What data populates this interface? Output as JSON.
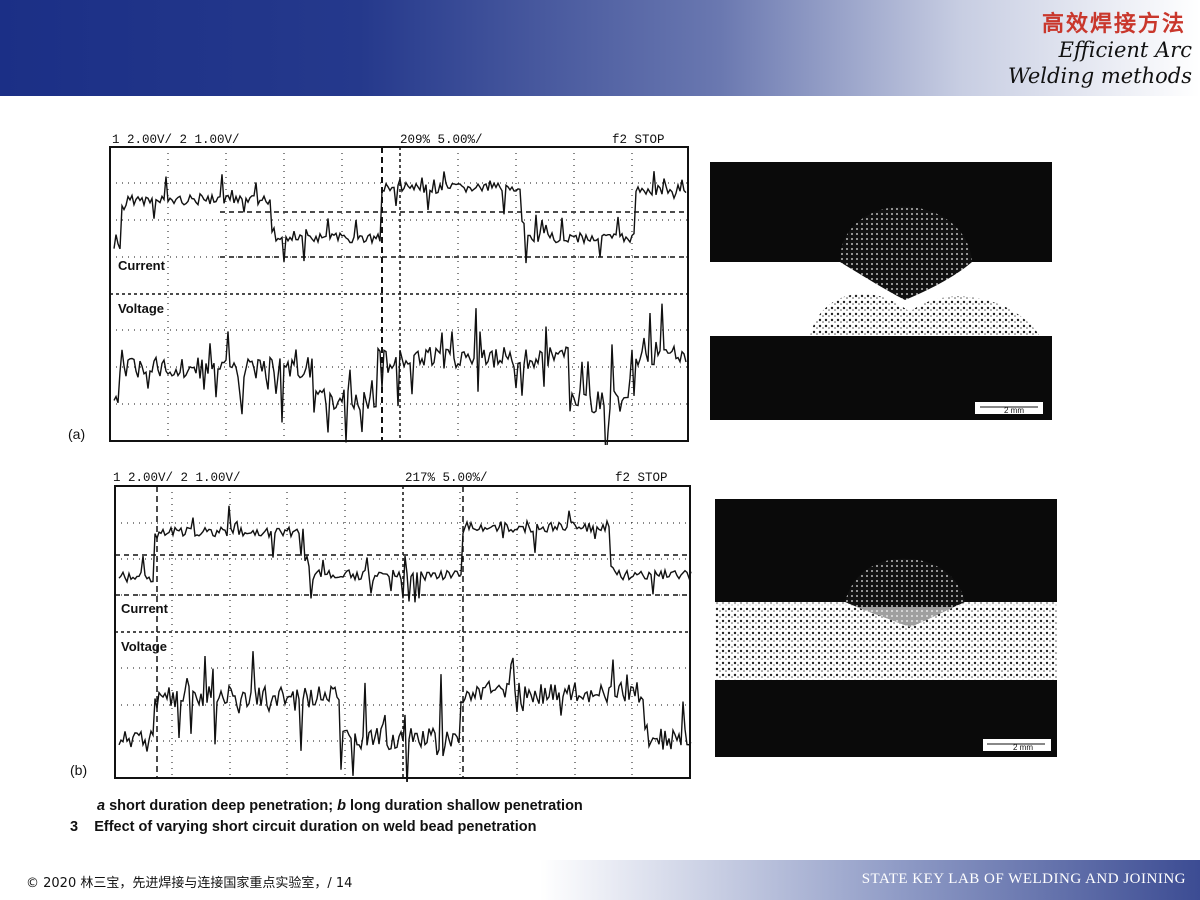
{
  "header": {
    "title_zh": "高效焊接方法",
    "title_en_line1": "Efficient Arc",
    "title_en_line2": "Welding methods"
  },
  "figure_a": {
    "panel_label": "(a)",
    "scope": {
      "ch_settings": "1 2.00V/   2 1.00V/",
      "timebase": "209% 5.00%/",
      "status": "f2  STOP",
      "current_label": "Current",
      "voltage_label": "Voltage"
    },
    "scale_bar": "2 mm"
  },
  "figure_b": {
    "panel_label": "(b)",
    "scope": {
      "ch_settings": "1 2.00V/   2 1.00V/",
      "timebase": "217% 5.00%/",
      "status": "f2  STOP",
      "current_label": "Current",
      "voltage_label": "Voltage"
    },
    "scale_bar": "2 mm"
  },
  "caption": {
    "line1_a": "a",
    "line1_a_text": "short duration deep penetration;",
    "line1_b": "b",
    "line1_b_text": "long duration shallow penetration",
    "line2_num": "3",
    "line2_text": "Effect of varying short circuit duration on weld bead penetration"
  },
  "footer": {
    "left": "©     2020  林三宝，先进焊接与连接国家重点实验室，/ 14",
    "right": "STATE KEY LAB OF WELDING AND JOINING"
  }
}
